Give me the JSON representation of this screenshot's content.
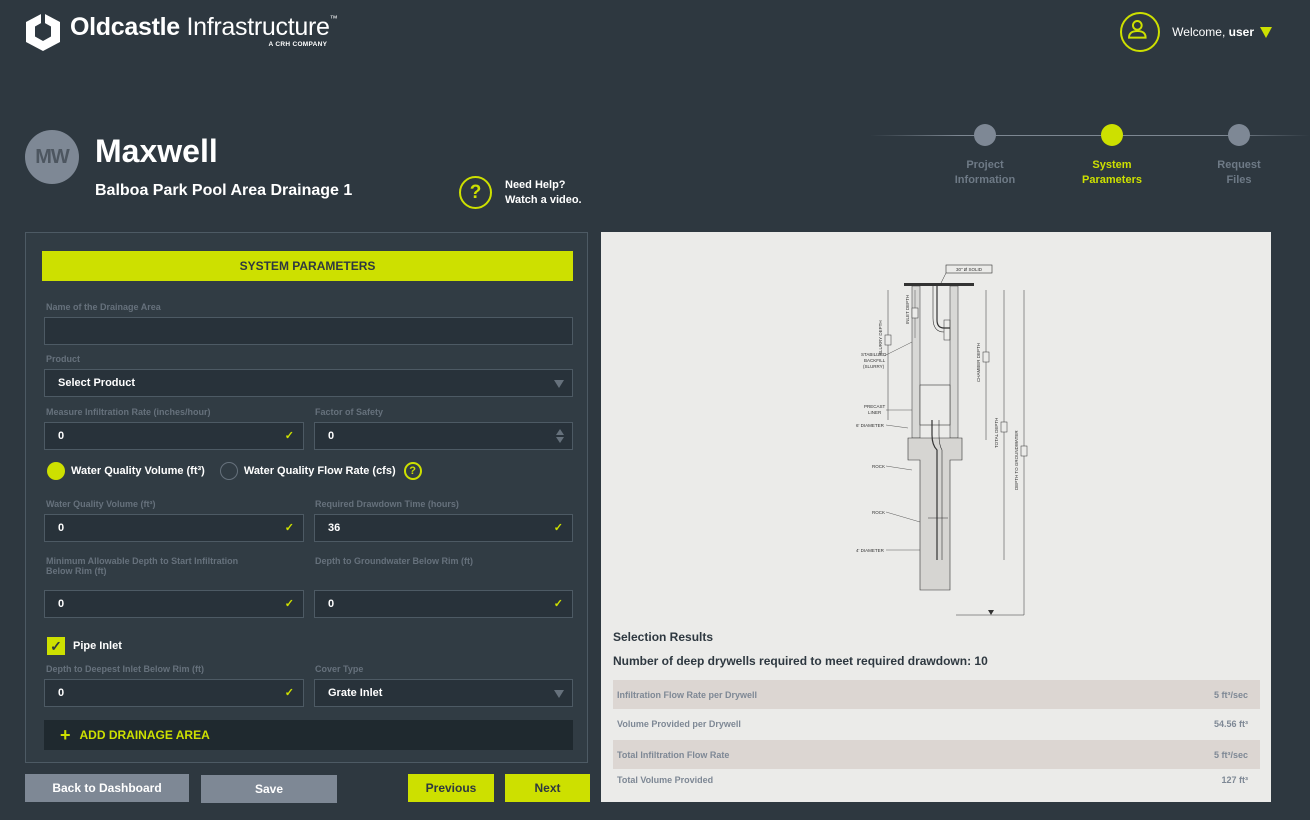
{
  "brand": {
    "name_bold": "Oldcastle",
    "name_light": "Infrastructure",
    "trademark": "™",
    "tagline": "A CRH COMPANY"
  },
  "user": {
    "welcome": "Welcome, ",
    "name": "user"
  },
  "project": {
    "initials": "MW",
    "name": "Maxwell",
    "subtitle": "Balboa Park Pool Area Drainage 1"
  },
  "help": {
    "line1": "Need Help?",
    "line2": "Watch a video."
  },
  "stepper": {
    "steps": [
      {
        "line1": "Project",
        "line2": "Information",
        "active": false
      },
      {
        "line1": "System",
        "line2": "Parameters",
        "active": true
      },
      {
        "line1": "Request",
        "line2": "Files",
        "active": false
      }
    ]
  },
  "form": {
    "header": "SYSTEM PARAMETERS",
    "drainage_area_name": {
      "label": "Name of the Drainage Area",
      "value": ""
    },
    "product": {
      "label": "Product",
      "value": "Select Product"
    },
    "infiltration_rate": {
      "label": "Measure Infiltration Rate (inches/hour)",
      "value": "0"
    },
    "factor_of_safety": {
      "label": "Factor of Safety",
      "value": "0"
    },
    "radio_volume": {
      "label": "Water Quality Volume (ft³)",
      "selected": true
    },
    "radio_flow": {
      "label": "Water Quality Flow Rate (cfs)",
      "selected": false
    },
    "water_quality_volume": {
      "label": "Water Quality Volume (ft³)",
      "value": "0"
    },
    "drawdown_time": {
      "label": "Required Drawdown Time (hours)",
      "value": "36"
    },
    "min_depth": {
      "label_line1": "Minimum  Allowable Depth to Start Infiltration",
      "label_line2": "Below Rim (ft)",
      "value": "0"
    },
    "groundwater_depth": {
      "label": "Depth to Groundwater Below Rim (ft)",
      "value": "0"
    },
    "pipe_inlet": {
      "label": "Pipe Inlet",
      "checked": true
    },
    "deepest_inlet": {
      "label": "Depth to Deepest Inlet Below Rim (ft)",
      "value": "0"
    },
    "cover_type": {
      "label": "Cover Type",
      "value": "Grate Inlet"
    },
    "add_area": "ADD DRAINAGE AREA"
  },
  "buttons": {
    "back": "Back to Dashboard",
    "save": "Save",
    "previous": "Previous",
    "next": "Next"
  },
  "diagram": {
    "labels": {
      "solid": "30\" Ø SOLID",
      "inlet_depth": "INLET DEPTH",
      "slurry_depth": "SLURRY DEPTH",
      "chamber_depth": "CHAMBER DEPTH",
      "backfill_1": "STABILIZED",
      "backfill_2": "BACKFILL",
      "backfill_3": "(SLURRY)",
      "liner_1": "PRECAST",
      "liner_2": "LINER",
      "dia6": "6' DIAMETER",
      "total_depth": "TOTAL DEPTH",
      "groundwater": "DEPTH TO GROUNDWATER",
      "rock1": "ROCK",
      "rock2": "ROCK",
      "dia4": "4' DIAMETER"
    }
  },
  "results": {
    "title": "Selection Results",
    "count_text": "Number of deep drywells required to meet required drawdown: 10",
    "rows": [
      {
        "label": "Infiltration Flow Rate per Drywell",
        "value": "5 ft³/sec"
      },
      {
        "label": "Volume Provided per Drywell",
        "value": "54.56 ft³"
      },
      {
        "label": "Total Infiltration Flow Rate",
        "value": "5 ft³/sec"
      },
      {
        "label": "Total Volume Provided",
        "value": "127 ft³"
      }
    ]
  },
  "colors": {
    "background": "#2e3840",
    "accent": "#cde000",
    "muted": "#7e8895",
    "panel": "#ebebe9"
  }
}
